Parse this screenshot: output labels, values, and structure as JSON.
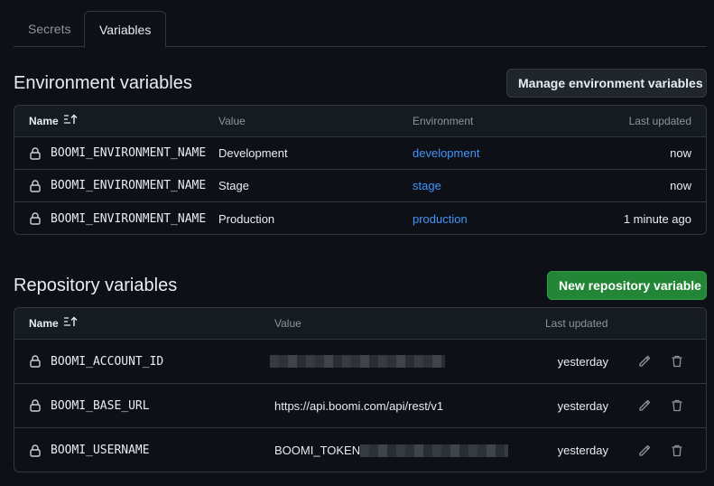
{
  "tabs": {
    "secrets": "Secrets",
    "variables": "Variables"
  },
  "environment": {
    "heading": "Environment variables",
    "manage_button": "Manage environment variables",
    "columns": {
      "name": "Name",
      "value": "Value",
      "environment": "Environment",
      "last_updated": "Last updated"
    },
    "rows": [
      {
        "name": "BOOMI_ENVIRONMENT_NAME",
        "value": "Development",
        "environment": "development",
        "updated": "now"
      },
      {
        "name": "BOOMI_ENVIRONMENT_NAME",
        "value": "Stage",
        "environment": "stage",
        "updated": "now"
      },
      {
        "name": "BOOMI_ENVIRONMENT_NAME",
        "value": "Production",
        "environment": "production",
        "updated": "1 minute ago"
      }
    ]
  },
  "repository": {
    "heading": "Repository variables",
    "new_button": "New repository variable",
    "columns": {
      "name": "Name",
      "value": "Value",
      "last_updated": "Last updated"
    },
    "rows": [
      {
        "name": "BOOMI_ACCOUNT_ID",
        "value": "",
        "updated": "yesterday"
      },
      {
        "name": "BOOMI_BASE_URL",
        "value": "https://api.boomi.com/api/rest/v1",
        "updated": "yesterday"
      },
      {
        "name": "BOOMI_USERNAME",
        "value": "BOOMI_TOKEN",
        "updated": "yesterday"
      }
    ]
  },
  "colors": {
    "background": "#0d1117",
    "link": "#4493f8",
    "primary_button": "#238636",
    "border": "#30363d"
  },
  "icons": {
    "lock": "lock-icon",
    "sort": "sort-ascending-icon",
    "edit": "pencil-icon",
    "delete": "trash-icon"
  }
}
